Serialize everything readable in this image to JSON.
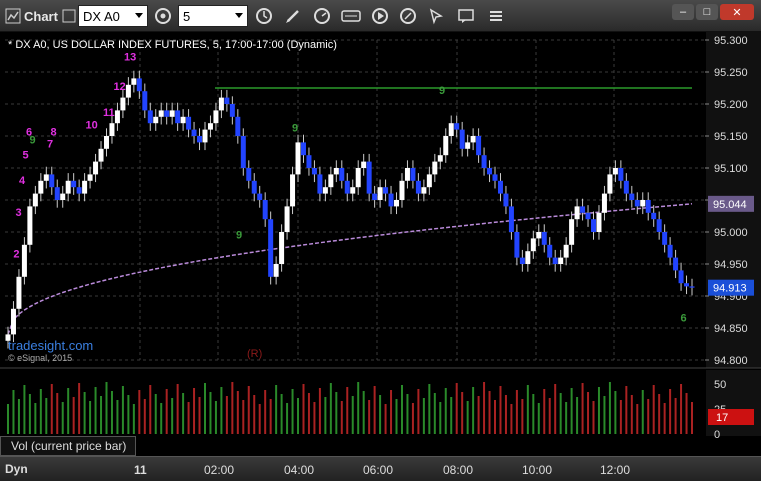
{
  "toolbar": {
    "app_label": "Chart",
    "symbol": "DX A0",
    "interval": "5"
  },
  "chart": {
    "header": "* DX A0, US DOLLAR INDEX FUTURES, 5, 17:00-17:00 (Dynamic)",
    "watermark": "tradesight.com",
    "copyright": "© eSignal, 2015",
    "rollover_marker": "(R)"
  },
  "chart_data": {
    "type": "candlestick",
    "ylim": [
      94.8,
      95.3
    ],
    "y_ticks": [
      "95.300",
      "95.250",
      "95.200",
      "95.150",
      "95.100",
      "95.050",
      "95.000",
      "94.950",
      "94.900",
      "94.850",
      "94.800"
    ],
    "x_ticks": [
      "11",
      "02:00",
      "04:00",
      "06:00",
      "08:00",
      "10:00",
      "12:00"
    ],
    "closes": [
      94.84,
      94.88,
      94.93,
      94.98,
      95.04,
      95.06,
      95.08,
      95.09,
      95.07,
      95.05,
      95.06,
      95.08,
      95.07,
      95.06,
      95.08,
      95.09,
      95.11,
      95.13,
      95.15,
      95.17,
      95.19,
      95.21,
      95.23,
      95.24,
      95.22,
      95.19,
      95.17,
      95.18,
      95.19,
      95.18,
      95.19,
      95.17,
      95.18,
      95.16,
      95.15,
      95.14,
      95.16,
      95.17,
      95.19,
      95.21,
      95.2,
      95.18,
      95.15,
      95.1,
      95.08,
      95.06,
      95.05,
      95.02,
      94.93,
      94.95,
      95.0,
      95.04,
      95.09,
      95.14,
      95.12,
      95.1,
      95.09,
      95.06,
      95.07,
      95.09,
      95.1,
      95.08,
      95.06,
      95.07,
      95.1,
      95.11,
      95.06,
      95.05,
      95.07,
      95.06,
      95.04,
      95.05,
      95.08,
      95.1,
      95.08,
      95.06,
      95.07,
      95.09,
      95.11,
      95.12,
      95.15,
      95.17,
      95.16,
      95.13,
      95.14,
      95.15,
      95.12,
      95.1,
      95.09,
      95.08,
      95.06,
      95.04,
      95.0,
      94.96,
      94.95,
      94.97,
      94.99,
      95.0,
      94.98,
      94.96,
      94.95,
      94.96,
      94.98,
      95.02,
      95.04,
      95.03,
      95.02,
      95.0,
      95.03,
      95.06,
      95.09,
      95.1,
      95.08,
      95.06,
      95.05,
      95.04,
      95.05,
      95.03,
      95.02,
      95.0,
      94.98,
      94.96,
      94.94,
      94.92,
      94.915,
      94.913
    ],
    "sma_start": 94.84,
    "sma_end": 95.044,
    "resistance_level": 95.225,
    "last_price": "94.913",
    "ma_value": "95.044",
    "volume": {
      "ylim": [
        0,
        60
      ],
      "y_ticks": [
        "50",
        "25",
        "0"
      ],
      "last_value": "17",
      "label": "Vol (current price bar)"
    },
    "annotations": [
      {
        "text": "13",
        "x": 0.17,
        "y": 95.268,
        "color": "#e030e0"
      },
      {
        "text": "12",
        "x": 0.155,
        "y": 95.222,
        "color": "#e030e0"
      },
      {
        "text": "11",
        "x": 0.14,
        "y": 95.181,
        "color": "#e030e0"
      },
      {
        "text": "10",
        "x": 0.115,
        "y": 95.162,
        "color": "#e030e0"
      },
      {
        "text": "8",
        "x": 0.065,
        "y": 95.151,
        "color": "#e030e0"
      },
      {
        "text": "6",
        "x": 0.03,
        "y": 95.151,
        "color": "#e030e0"
      },
      {
        "text": "7",
        "x": 0.06,
        "y": 95.132,
        "color": "#e030e0"
      },
      {
        "text": "5",
        "x": 0.025,
        "y": 95.115,
        "color": "#e030e0"
      },
      {
        "text": "4",
        "x": 0.02,
        "y": 95.075,
        "color": "#e030e0"
      },
      {
        "text": "3",
        "x": 0.015,
        "y": 95.025,
        "color": "#e030e0"
      },
      {
        "text": "2",
        "x": 0.012,
        "y": 94.96,
        "color": "#e030e0"
      },
      {
        "text": "9",
        "x": 0.035,
        "y": 95.138,
        "color": "#3a9a3a"
      },
      {
        "text": "9",
        "x": 0.62,
        "y": 95.216,
        "color": "#3a9a3a"
      },
      {
        "text": "9",
        "x": 0.41,
        "y": 95.157,
        "color": "#3a9a3a"
      },
      {
        "text": "9",
        "x": 0.33,
        "y": 94.99,
        "color": "#3a9a3a"
      },
      {
        "text": "6",
        "x": 0.965,
        "y": 94.86,
        "color": "#3a9a3a"
      }
    ]
  }
}
